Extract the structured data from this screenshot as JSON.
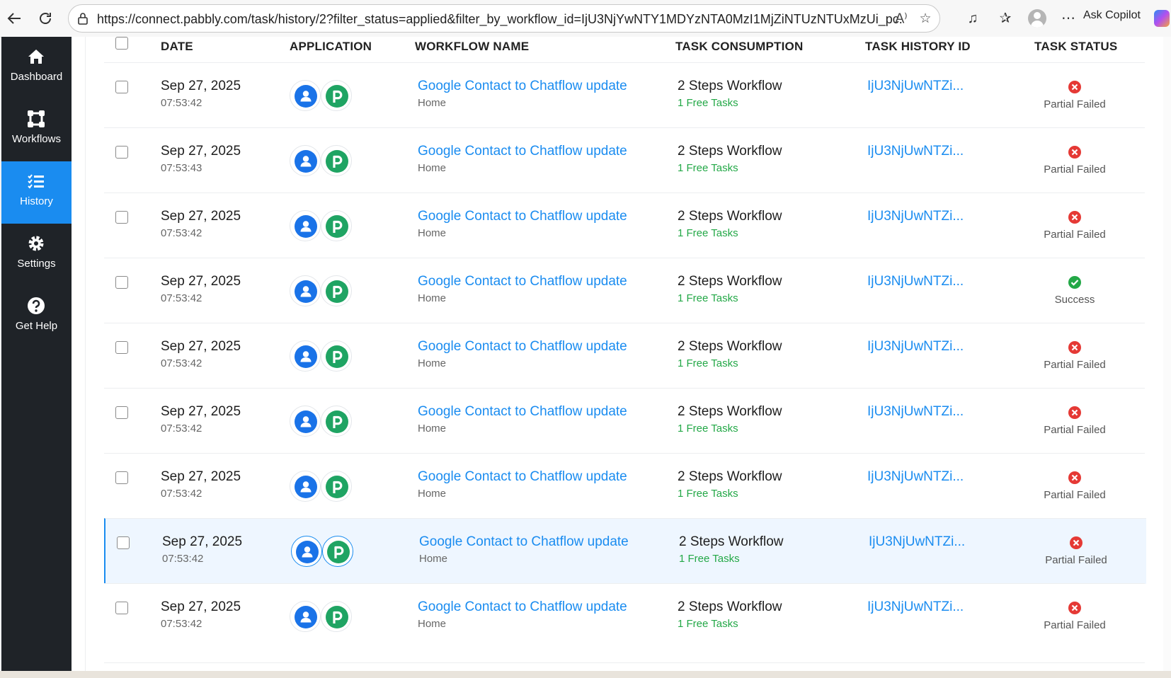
{
  "browser": {
    "url": "https://connect.pabbly.com/task/history/2?filter_status=applied&filter_by_workflow_id=IjU3NjYwNTY1MDYzNTA0MzI1MjZiNTUzNTUxMzUi_pc...",
    "copilot_label": "Ask Copilot"
  },
  "sidebar": {
    "items": [
      {
        "label": "Dashboard",
        "icon": "home-icon"
      },
      {
        "label": "Workflows",
        "icon": "workflow-icon"
      },
      {
        "label": "History",
        "icon": "list-icon"
      },
      {
        "label": "Settings",
        "icon": "gear-icon"
      },
      {
        "label": "Get Help",
        "icon": "help-icon"
      }
    ],
    "active": "History"
  },
  "table": {
    "headers": [
      "DATE",
      "APPLICATION",
      "WORKFLOW NAME",
      "TASK CONSUMPTION",
      "TASK HISTORY ID",
      "TASK STATUS"
    ],
    "rows": [
      {
        "date": "Sep 27, 2025",
        "time": "07:53:42",
        "workflow": "Google Contact to Chatflow update",
        "folder": "Home",
        "consumption": "2 Steps Workflow",
        "tasks": "1 Free Tasks",
        "task_id": "IjU3NjUwNTZi...",
        "status": "Partial Failed"
      },
      {
        "date": "Sep 27, 2025",
        "time": "07:53:43",
        "workflow": "Google Contact to Chatflow update",
        "folder": "Home",
        "consumption": "2 Steps Workflow",
        "tasks": "1 Free Tasks",
        "task_id": "IjU3NjUwNTZi...",
        "status": "Partial Failed"
      },
      {
        "date": "Sep 27, 2025",
        "time": "07:53:42",
        "workflow": "Google Contact to Chatflow update",
        "folder": "Home",
        "consumption": "2 Steps Workflow",
        "tasks": "1 Free Tasks",
        "task_id": "IjU3NjUwNTZi...",
        "status": "Partial Failed"
      },
      {
        "date": "Sep 27, 2025",
        "time": "07:53:42",
        "workflow": "Google Contact to Chatflow update",
        "folder": "Home",
        "consumption": "2 Steps Workflow",
        "tasks": "1 Free Tasks",
        "task_id": "IjU3NjUwNTZi...",
        "status": "Success"
      },
      {
        "date": "Sep 27, 2025",
        "time": "07:53:42",
        "workflow": "Google Contact to Chatflow update",
        "folder": "Home",
        "consumption": "2 Steps Workflow",
        "tasks": "1 Free Tasks",
        "task_id": "IjU3NjUwNTZi...",
        "status": "Partial Failed"
      },
      {
        "date": "Sep 27, 2025",
        "time": "07:53:42",
        "workflow": "Google Contact to Chatflow update",
        "folder": "Home",
        "consumption": "2 Steps Workflow",
        "tasks": "1 Free Tasks",
        "task_id": "IjU3NjUwNTZi...",
        "status": "Partial Failed"
      },
      {
        "date": "Sep 27, 2025",
        "time": "07:53:42",
        "workflow": "Google Contact to Chatflow update",
        "folder": "Home",
        "consumption": "2 Steps Workflow",
        "tasks": "1 Free Tasks",
        "task_id": "IjU3NjUwNTZi...",
        "status": "Partial Failed"
      },
      {
        "date": "Sep 27, 2025",
        "time": "07:53:42",
        "workflow": "Google Contact to Chatflow update",
        "folder": "Home",
        "consumption": "2 Steps Workflow",
        "tasks": "1 Free Tasks",
        "task_id": "IjU3NjUwNTZi...",
        "status": "Partial Failed",
        "highlighted": true
      },
      {
        "date": "Sep 27, 2025",
        "time": "07:53:42",
        "workflow": "Google Contact to Chatflow update",
        "folder": "Home",
        "consumption": "2 Steps Workflow",
        "tasks": "1 Free Tasks",
        "task_id": "IjU3NjUwNTZi...",
        "status": "Partial Failed"
      }
    ]
  },
  "colors": {
    "accent": "#1a8cf0",
    "sidebar_bg": "#1f2328",
    "success": "#23a847",
    "failed": "#e53935",
    "google_contacts": "#1a73e8",
    "pabbly_chatflow": "#1fa463"
  }
}
